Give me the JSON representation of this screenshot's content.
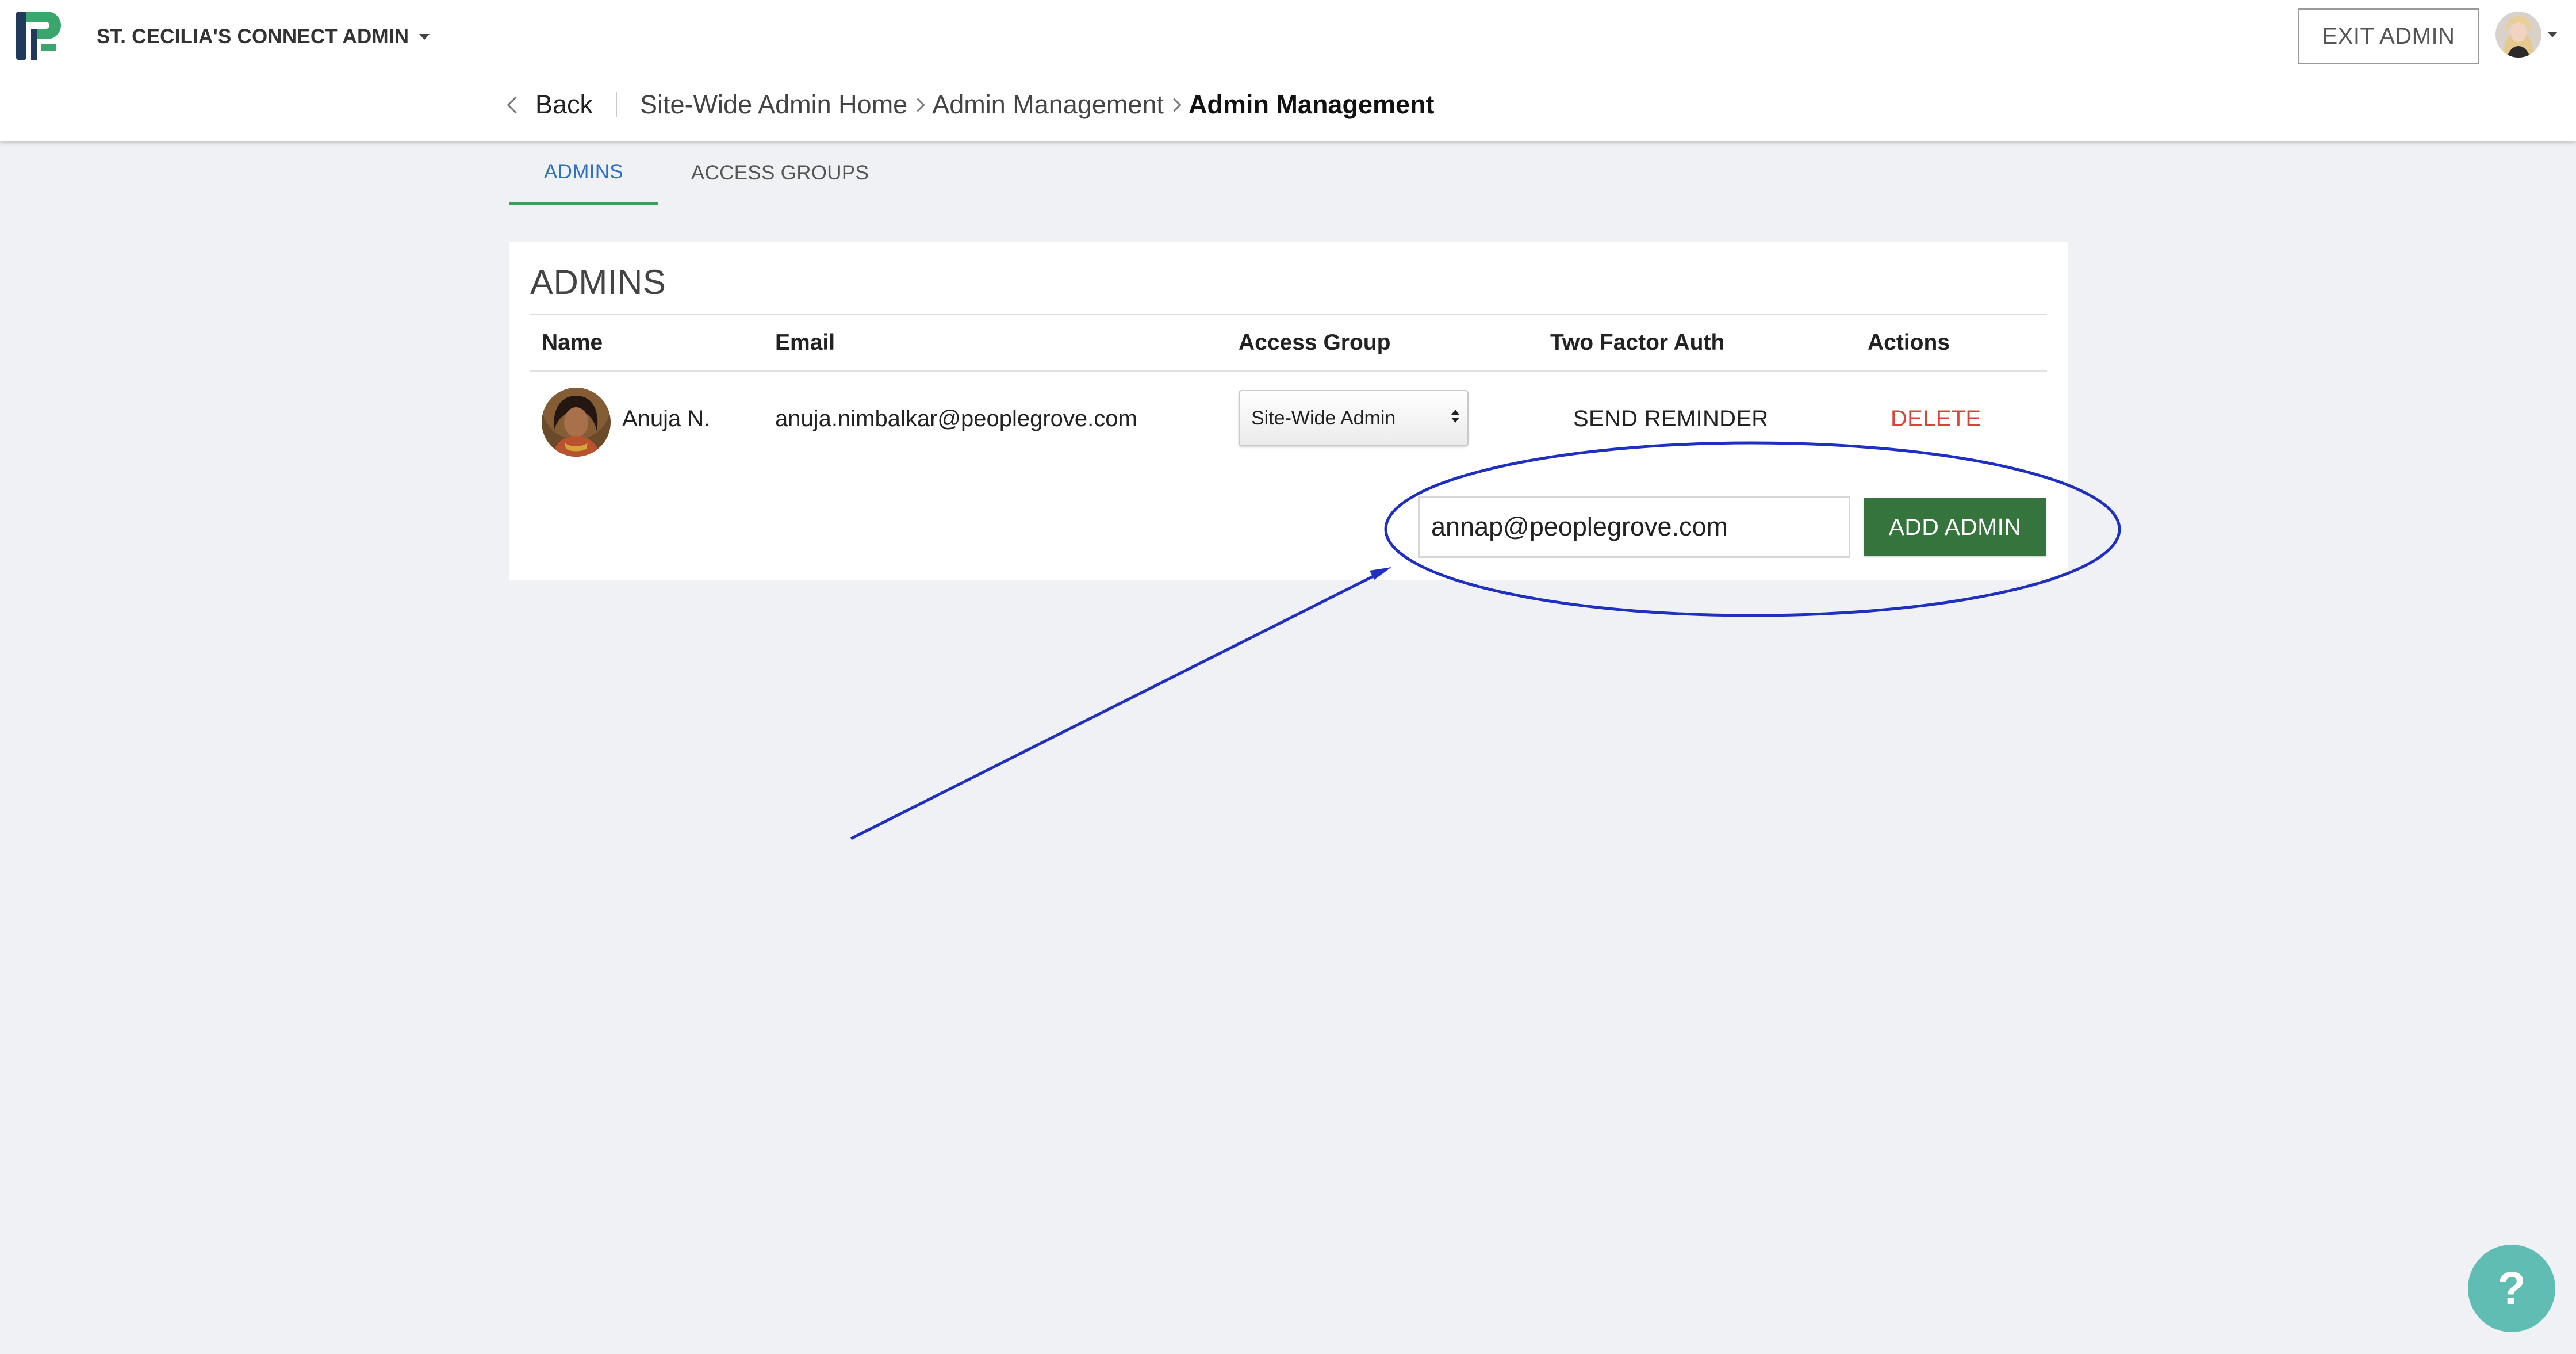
{
  "header": {
    "site_name": "ST. CECILIA'S CONNECT ADMIN",
    "exit_admin_label": "EXIT ADMIN"
  },
  "breadcrumb": {
    "back_label": "Back",
    "items": [
      "Site-Wide Admin Home",
      "Admin Management"
    ],
    "current": "Admin Management"
  },
  "tabs": [
    {
      "label": "ADMINS",
      "active": true
    },
    {
      "label": "ACCESS GROUPS",
      "active": false
    }
  ],
  "admins_panel": {
    "title": "ADMINS",
    "columns": [
      "Name",
      "Email",
      "Access Group",
      "Two Factor Auth",
      "Actions"
    ],
    "rows": [
      {
        "name": "Anuja N.",
        "email": "anuja.nimbalkar@peoplegrove.com",
        "access_group": "Site-Wide Admin",
        "two_factor_action": "SEND REMINDER",
        "action": "DELETE"
      }
    ],
    "new_admin_email_value": "annap@peoplegrove.com",
    "add_admin_label": "ADD ADMIN"
  },
  "help": {
    "label": "?"
  },
  "colors": {
    "tab_active_text": "#2f6fc4",
    "tab_active_underline": "#3e9d5a",
    "add_admin_button": "#35743d",
    "delete_link": "#d9443a",
    "help_button": "#5fbdb3",
    "annotation": "#1f2fbf"
  },
  "icons": {
    "logo": "peoplegrove-logo-icon",
    "site_dropdown": "caret-down-icon",
    "user_menu": "caret-down-icon",
    "back": "chevron-left-icon",
    "breadcrumb_separator": "chevron-right-icon",
    "select": "select-arrows-icon"
  }
}
